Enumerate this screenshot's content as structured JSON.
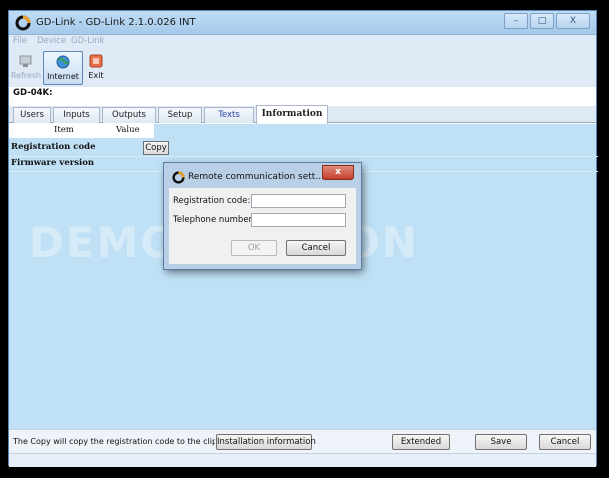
{
  "window": {
    "title": "GD-Link - GD-Link 2.1.0.026 INT",
    "minimize_glyph": "–",
    "maximize_glyph": "□",
    "close_glyph": "X"
  },
  "menu": [
    "File",
    "Device",
    "GD-Link"
  ],
  "toolbar": {
    "refresh_label": "Refresh",
    "internet_label": "Internet",
    "exit_label": "Exit"
  },
  "device_label": "GD-04K:",
  "tabs": [
    "Users",
    "Inputs",
    "Outputs",
    "Setup",
    "Texts",
    "Information"
  ],
  "active_tab": "Information",
  "table": {
    "columns": [
      "Item",
      "Value"
    ],
    "rows": [
      "Registration code",
      "Firmware version"
    ],
    "copy_label": "Copy"
  },
  "watermark": "DEMO VERSION",
  "dialog": {
    "title": "Remote communication sett...",
    "close_glyph": "x",
    "registration_label": "Registration code:",
    "registration_value": "",
    "telephone_label": "Telephone number:",
    "telephone_value": "",
    "ok_label": "OK",
    "cancel_label": "Cancel"
  },
  "bottom": {
    "info_text": "The Copy will copy the registration code to the clipboard",
    "installation_label": "Installation information",
    "extended_label": "Extended",
    "save_label": "Save",
    "cancel_label": "Cancel"
  },
  "colors": {
    "content_bg": "#bfe0f5",
    "title_bar": "#a6c9ea",
    "dialog_close": "#c3402c"
  },
  "icons": [
    "gd-link-logo-icon",
    "refresh-icon",
    "internet-globe-icon",
    "exit-icon"
  ]
}
